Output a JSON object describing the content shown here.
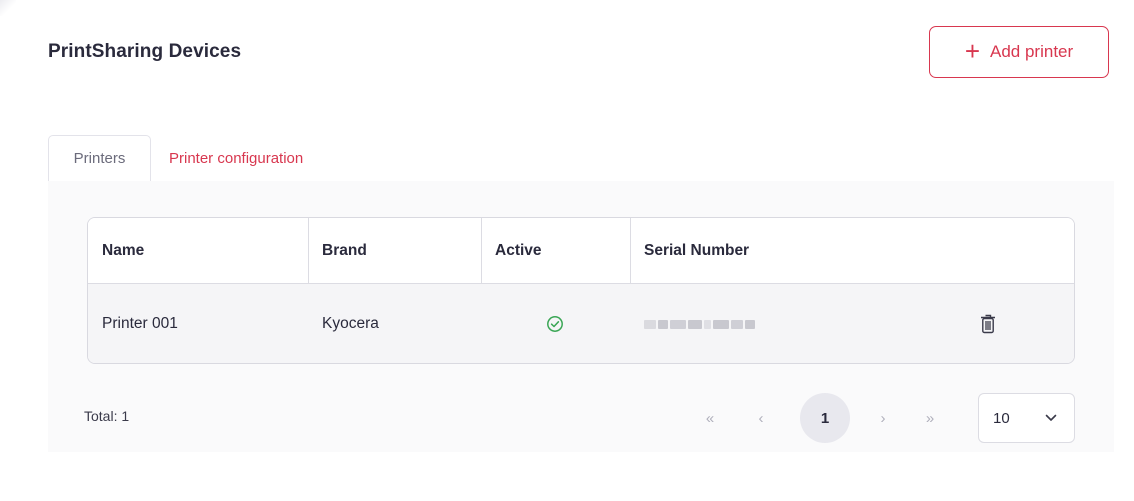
{
  "page": {
    "title": "PrintSharing Devices"
  },
  "header": {
    "add_button_icon": "plus-icon",
    "add_button_label": "Add printer",
    "accent_color": "#d8374f"
  },
  "tabs": [
    {
      "label": "Printers",
      "active": true
    },
    {
      "label": "Printer configuration",
      "active": false
    }
  ],
  "table": {
    "columns": [
      "Name",
      "Brand",
      "Active",
      "Serial Number"
    ],
    "rows": [
      {
        "name": "Printer 001",
        "brand": "Kyocera",
        "active_icon": "check-circle-icon",
        "serial_number_redacted": true,
        "action_icon": "trash-icon"
      }
    ]
  },
  "footer": {
    "total_label": "Total: 1",
    "pagination": {
      "first": "«",
      "prev": "‹",
      "current_page": "1",
      "next": "›",
      "last": "»"
    },
    "page_size": {
      "selected": "10",
      "icon": "chevron-down-icon"
    }
  }
}
